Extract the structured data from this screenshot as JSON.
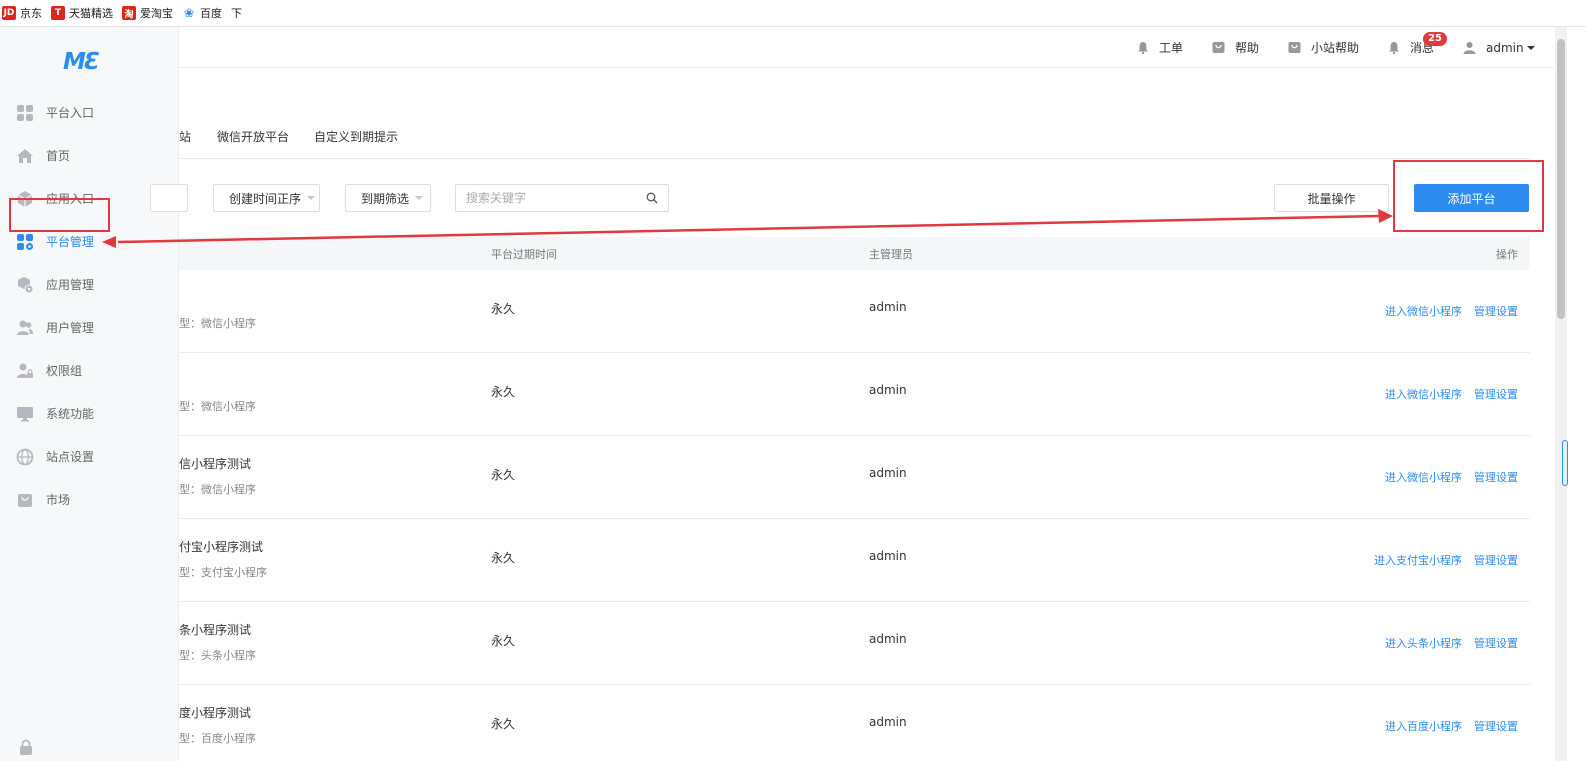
{
  "bookmarks": [
    {
      "label": "京东",
      "icon": "jd-icon",
      "color": "#e1251b",
      "glyph": "JD"
    },
    {
      "label": "天猫精选",
      "icon": "tmall-icon",
      "color": "#e1251b",
      "glyph": "T"
    },
    {
      "label": "爱淘宝",
      "icon": "aitaobao-icon",
      "color": "#e1251b",
      "glyph": "淘"
    },
    {
      "label": "百度",
      "icon": "baidu-paw-icon",
      "color": "#2d8cf0",
      "glyph": "❀"
    },
    {
      "label": "下",
      "icon": "",
      "color": "",
      "glyph": ""
    }
  ],
  "logo": "MƐ",
  "sidebar": {
    "items": [
      {
        "label": "平台入口",
        "icon": "grid-icon"
      },
      {
        "label": "首页",
        "icon": "home-icon"
      },
      {
        "label": "应用入口",
        "icon": "box-icon"
      },
      {
        "label": "平台管理",
        "icon": "grid-gear-icon",
        "active": true
      },
      {
        "label": "应用管理",
        "icon": "cube-gear-icon"
      },
      {
        "label": "用户管理",
        "icon": "users-icon"
      },
      {
        "label": "权限组",
        "icon": "user-lock-icon"
      },
      {
        "label": "系统功能",
        "icon": "monitor-icon"
      },
      {
        "label": "站点设置",
        "icon": "globe-icon"
      },
      {
        "label": "市场",
        "icon": "bag-icon"
      }
    ]
  },
  "header": {
    "workorder": "工单",
    "help": "帮助",
    "site_help": "小站帮助",
    "messages": "消息",
    "messages_badge": "25",
    "user": "admin"
  },
  "tabs": [
    "站",
    "微信开放平台",
    "自定义到期提示"
  ],
  "filters": {
    "sort": "创建时间正序",
    "expiry": "到期筛选",
    "search_placeholder": "搜索关键字",
    "batch": "批量操作",
    "add": "添加平台"
  },
  "table": {
    "columns": {
      "expiry": "平台过期时间",
      "admin": "主管理员",
      "ops": "操作"
    },
    "rows": [
      {
        "name": "",
        "type": "型：微信小程序",
        "expiry": "永久",
        "admin": "admin",
        "enter": "进入微信小程序",
        "manage": "管理设置"
      },
      {
        "name": "",
        "type": "型：微信小程序",
        "expiry": "永久",
        "admin": "admin",
        "enter": "进入微信小程序",
        "manage": "管理设置"
      },
      {
        "name": "信小程序测试",
        "type": "型：微信小程序",
        "expiry": "永久",
        "admin": "admin",
        "enter": "进入微信小程序",
        "manage": "管理设置"
      },
      {
        "name": "付宝小程序测试",
        "type": "型：支付宝小程序",
        "expiry": "永久",
        "admin": "admin",
        "enter": "进入支付宝小程序",
        "manage": "管理设置"
      },
      {
        "name": "条小程序测试",
        "type": "型：头条小程序",
        "expiry": "永久",
        "admin": "admin",
        "enter": "进入头条小程序",
        "manage": "管理设置"
      },
      {
        "name": "度小程序测试",
        "type": "型：百度小程序",
        "expiry": "永久",
        "admin": "admin",
        "enter": "进入百度小程序",
        "manage": "管理设置"
      }
    ]
  },
  "colors": {
    "accent": "#2d8cf0",
    "annotation": "#e0393e"
  }
}
